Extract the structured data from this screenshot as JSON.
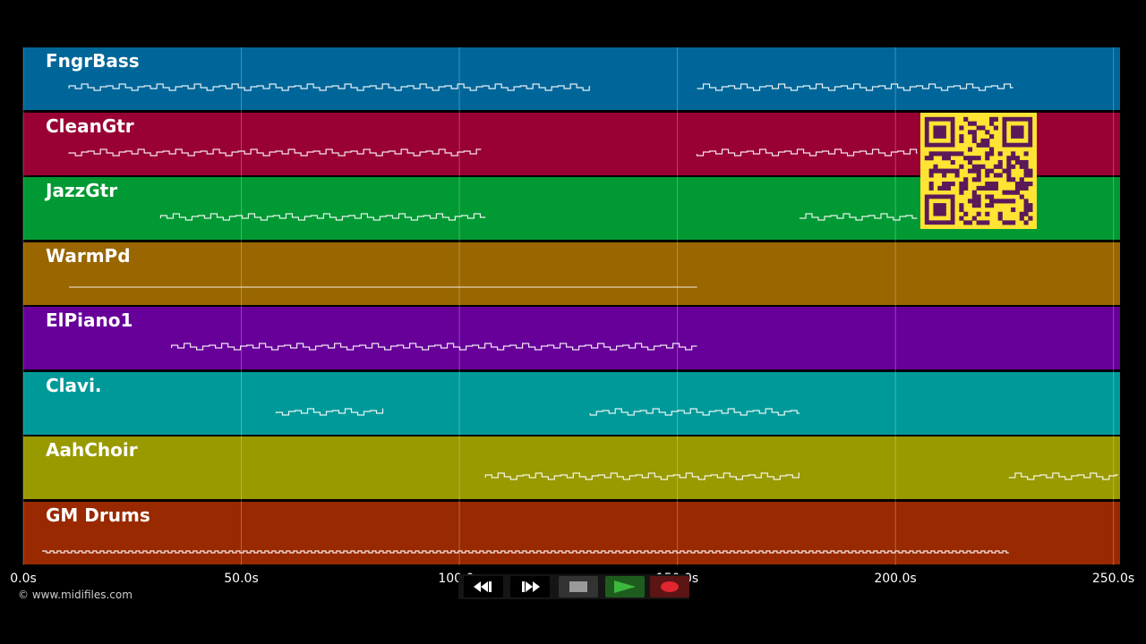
{
  "tracks": [
    {
      "name": "FngrBass",
      "color": "#006699"
    },
    {
      "name": "CleanGtr",
      "color": "#990033"
    },
    {
      "name": "JazzGtr",
      "color": "#009933"
    },
    {
      "name": "WarmPd",
      "color": "#996600"
    },
    {
      "name": "ElPiano1",
      "color": "#660099"
    },
    {
      "name": "Clavi.",
      "color": "#009999"
    },
    {
      "name": "AahChoir",
      "color": "#999900"
    },
    {
      "name": "GM Drums",
      "color": "#992900"
    }
  ],
  "timeline": {
    "ticks": [
      "0.0s",
      "50.0s",
      "100.0s",
      "150.0s",
      "200.0s",
      "250.0s"
    ],
    "tick_values": [
      0,
      50,
      100,
      150,
      200,
      250
    ],
    "range": [
      0,
      251.5
    ]
  },
  "credit": "© www.midifiles.com",
  "transport": {
    "buttons": [
      {
        "name": "rewind-button",
        "icon": "rewind-icon"
      },
      {
        "name": "fast-forward-button",
        "icon": "fast-forward-icon"
      },
      {
        "name": "stop-button",
        "icon": "stop-icon"
      },
      {
        "name": "play-button",
        "icon": "play-icon",
        "color": "#2e8b2e"
      },
      {
        "name": "record-button",
        "icon": "record-icon",
        "color": "#8b1a1a"
      }
    ]
  },
  "overlay": {
    "icon": "qr-code-icon",
    "color": "#ffe433",
    "ink": "#5a1a5a"
  },
  "note_segments": [
    [
      [
        10.5,
        130
      ],
      [
        154.5,
        227
      ]
    ],
    [
      [
        10.5,
        105
      ],
      [
        154.5,
        205
      ]
    ],
    [
      [
        31.5,
        106
      ],
      [
        178,
        205
      ]
    ],
    [
      [
        10.5,
        154.5
      ]
    ],
    [
      [
        34,
        154.5
      ]
    ],
    [
      [
        58,
        82.5
      ],
      [
        130,
        178
      ]
    ],
    [
      [
        106,
        178
      ],
      [
        226,
        251
      ]
    ],
    [
      [
        4.5,
        226
      ]
    ]
  ]
}
